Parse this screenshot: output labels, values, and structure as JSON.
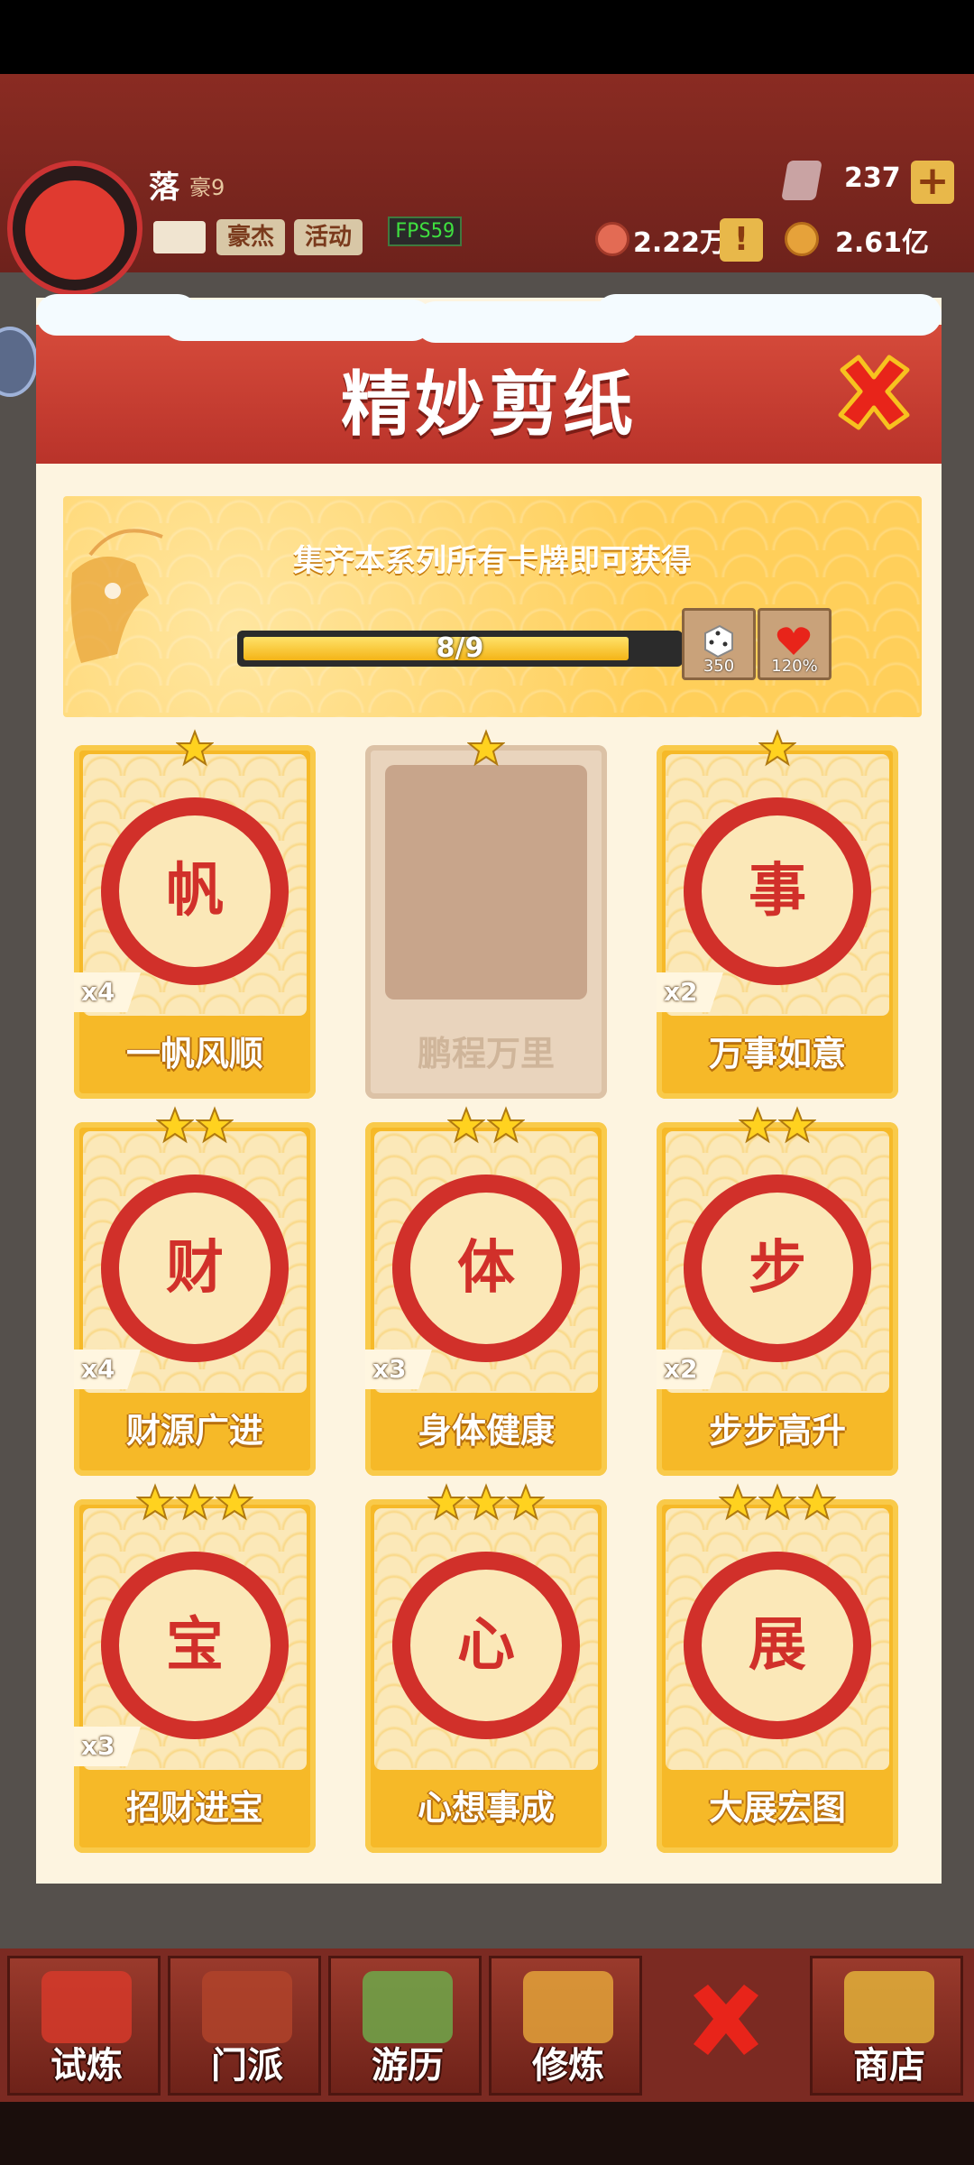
{
  "header": {
    "player_name": "落",
    "player_rank": "豪9",
    "buttons": [
      "豪杰",
      "活动"
    ],
    "fps": "FPS59",
    "gems": "237",
    "plus": "+",
    "currency1": "2.22万",
    "currency2": "2.61亿",
    "warn": "!"
  },
  "modal": {
    "title": "精妙剪纸",
    "banner_text": "集齐本系列所有卡牌即可获得",
    "progress_text": "8/9",
    "progress": 0.889,
    "rewards": [
      {
        "icon": "dice-icon",
        "label": "350"
      },
      {
        "icon": "heart-icon",
        "label": "120%"
      }
    ],
    "cards": [
      {
        "name": "一帆风顺",
        "stars": 1,
        "count": "x4",
        "glyph": "帆",
        "locked": false
      },
      {
        "name": "鹏程万里",
        "stars": 1,
        "count": "",
        "glyph": "",
        "locked": true
      },
      {
        "name": "万事如意",
        "stars": 1,
        "count": "x2",
        "glyph": "事",
        "locked": false
      },
      {
        "name": "财源广进",
        "stars": 2,
        "count": "x4",
        "glyph": "财",
        "locked": false
      },
      {
        "name": "身体健康",
        "stars": 2,
        "count": "x3",
        "glyph": "体",
        "locked": false
      },
      {
        "name": "步步高升",
        "stars": 2,
        "count": "x2",
        "glyph": "步",
        "locked": false
      },
      {
        "name": "招财进宝",
        "stars": 3,
        "count": "x3",
        "glyph": "宝",
        "locked": false
      },
      {
        "name": "心想事成",
        "stars": 3,
        "count": "",
        "glyph": "心",
        "locked": false
      },
      {
        "name": "大展宏图",
        "stars": 3,
        "count": "",
        "glyph": "展",
        "locked": false
      }
    ]
  },
  "nav": {
    "items": [
      {
        "label": "试炼",
        "icon": "scroll-icon"
      },
      {
        "label": "门派",
        "icon": "temple-icon"
      },
      {
        "label": "游历",
        "icon": "mountain-icon"
      },
      {
        "label": "修炼",
        "icon": "book-icon"
      },
      {
        "label": "",
        "icon": "close-icon"
      },
      {
        "label": "商店",
        "icon": "shop-icon"
      }
    ]
  },
  "colors": {
    "accent_red": "#d1302a",
    "card_gold": "#f6b928",
    "modal_bg": "#fdf4e0"
  }
}
